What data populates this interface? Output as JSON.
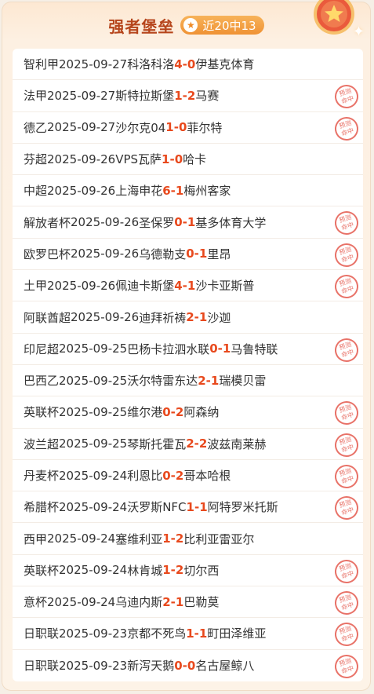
{
  "header": {
    "title": "强者堡垒",
    "badge_text": "近20中13"
  },
  "stamp_text": [
    "预测",
    "命中"
  ],
  "matches": [
    {
      "league": "智利甲",
      "date": "2025-09-27",
      "home": "科洛科洛",
      "hs": "4",
      "as": "0",
      "away": "伊基克体育",
      "hit": false
    },
    {
      "league": "法甲",
      "date": "2025-09-27",
      "home": "斯特拉斯堡",
      "hs": "1",
      "as": "2",
      "away": "马赛",
      "hit": true
    },
    {
      "league": "德乙",
      "date": "2025-09-27",
      "home": "沙尔克04",
      "hs": "1",
      "as": "0",
      "away": "菲尔特",
      "hit": true
    },
    {
      "league": "芬超",
      "date": "2025-09-26",
      "home": "VPS瓦萨",
      "hs": "1",
      "as": "0",
      "away": "哈卡",
      "hit": false
    },
    {
      "league": "中超",
      "date": "2025-09-26",
      "home": "上海申花",
      "hs": "6",
      "as": "1",
      "away": "梅州客家",
      "hit": false
    },
    {
      "league": "解放者杯",
      "date": "2025-09-26",
      "home": "圣保罗",
      "hs": "0",
      "as": "1",
      "away": "基多体育大学",
      "hit": true
    },
    {
      "league": "欧罗巴杯",
      "date": "2025-09-26",
      "home": "乌德勒支",
      "hs": "0",
      "as": "1",
      "away": "里昂",
      "hit": true
    },
    {
      "league": "土甲",
      "date": "2025-09-26",
      "home": "佩迪卡斯堡",
      "hs": "4",
      "as": "1",
      "away": "沙卡亚斯普",
      "hit": true
    },
    {
      "league": "阿联酋超",
      "date": "2025-09-26",
      "home": "迪拜祈祷",
      "hs": "2",
      "as": "1",
      "away": "沙迦",
      "hit": false
    },
    {
      "league": "印尼超",
      "date": "2025-09-25",
      "home": "巴杨卡拉泗水联",
      "hs": "0",
      "as": "1",
      "away": "马鲁特联",
      "hit": true
    },
    {
      "league": "巴西乙",
      "date": "2025-09-25",
      "home": "沃尔特雷东达",
      "hs": "2",
      "as": "1",
      "away": "瑞模贝雷",
      "hit": false
    },
    {
      "league": "英联杯",
      "date": "2025-09-25",
      "home": "维尔港",
      "hs": "0",
      "as": "2",
      "away": "阿森纳",
      "hit": true
    },
    {
      "league": "波兰超",
      "date": "2025-09-25",
      "home": "琴斯托霍瓦",
      "hs": "2",
      "as": "2",
      "away": "波兹南莱赫",
      "hit": true
    },
    {
      "league": "丹麦杯",
      "date": "2025-09-24",
      "home": "利恩比",
      "hs": "0",
      "as": "2",
      "away": "哥本哈根",
      "hit": true
    },
    {
      "league": "希腊杯",
      "date": "2025-09-24",
      "home": "沃罗斯NFC",
      "hs": "1",
      "as": "1",
      "away": "阿特罗米托斯",
      "hit": true
    },
    {
      "league": "西甲",
      "date": "2025-09-24",
      "home": "塞维利亚",
      "hs": "1",
      "as": "2",
      "away": "比利亚雷亚尔",
      "hit": false
    },
    {
      "league": "英联杯",
      "date": "2025-09-24",
      "home": "林肯城",
      "hs": "1",
      "as": "2",
      "away": "切尔西",
      "hit": true
    },
    {
      "league": "意杯",
      "date": "2025-09-24",
      "home": "乌迪内斯",
      "hs": "2",
      "as": "1",
      "away": "巴勒莫",
      "hit": true
    },
    {
      "league": "日职联",
      "date": "2025-09-23",
      "home": "京都不死鸟",
      "hs": "1",
      "as": "1",
      "away": "町田泽维亚",
      "hit": true
    },
    {
      "league": "日职联",
      "date": "2025-09-23",
      "home": "新泻天鹅",
      "hs": "0",
      "as": "0",
      "away": "名古屋鲸八",
      "hit": true
    }
  ]
}
